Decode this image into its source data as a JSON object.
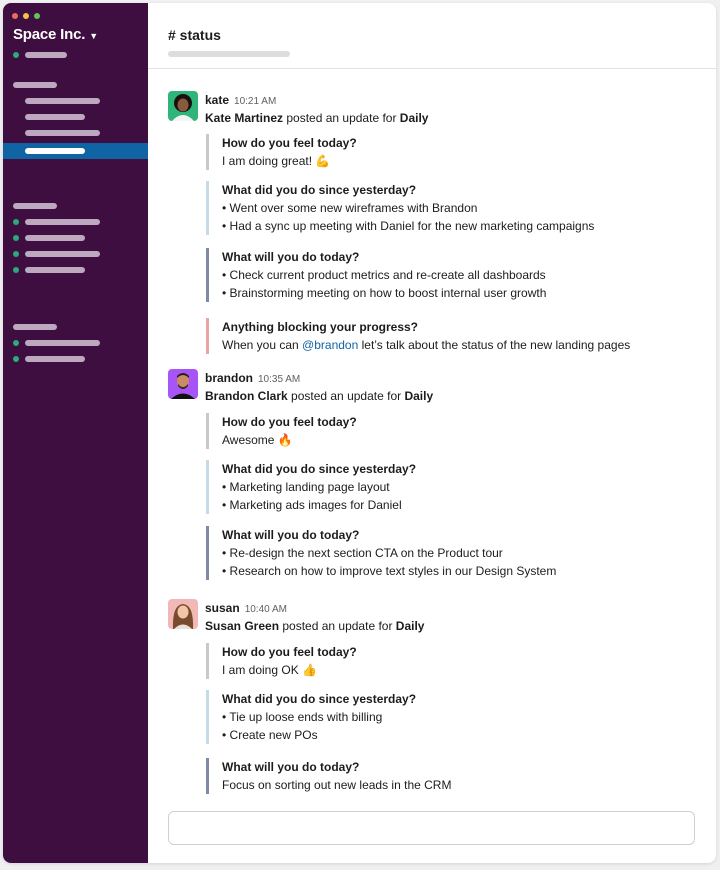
{
  "sidebar": {
    "workspace_name": "Space Inc.",
    "traffic_colors": [
      "#ed6a5e",
      "#f5bf4f",
      "#61c554"
    ],
    "sidebar_bg": "#3f0e40",
    "active_color": "#1164a3",
    "presence_color": "#2bac76"
  },
  "header": {
    "channel": "# status"
  },
  "messages": [
    {
      "user": "kate",
      "time": "10:21 AM",
      "full_name": "Kate Martinez",
      "posted_prefix": " posted an update for ",
      "standup": "Daily",
      "blocks": [
        {
          "color": "#c9c9c9",
          "q": "How do you feel today?",
          "lines": [
            "I am doing great! 💪"
          ]
        },
        {
          "color": "#c6dbe6",
          "q": "What did you do since yesterday?",
          "lines": [
            "• Went over some new wireframes with Brandon",
            "• Had a sync up meeting with Daniel for the new marketing campaigns"
          ]
        },
        {
          "color": "#7f8aa6",
          "q": "What will you do today?",
          "lines": [
            "• Check current product metrics and re-create all dashboards",
            "• Brainstorming meeting on how to boost internal user growth"
          ]
        },
        {
          "color": "#e6a6a6",
          "q": "Anything blocking your progress?",
          "lines": [
            "When you can ",
            "@brandon",
            " let’s talk about the status of the new landing pages"
          ]
        }
      ]
    },
    {
      "user": "brandon",
      "time": "10:35 AM",
      "full_name": "Brandon Clark",
      "posted_prefix": " posted an update for ",
      "standup": "Daily",
      "blocks": [
        {
          "color": "#c9c9c9",
          "q": "How do you feel today?",
          "lines": [
            "Awesome 🔥"
          ]
        },
        {
          "color": "#c6dbe6",
          "q": "What did you do since yesterday?",
          "lines": [
            "• Marketing landing page layout",
            "• Marketing ads images for Daniel"
          ]
        },
        {
          "color": "#7f8aa6",
          "q": "What will you do today?",
          "lines": [
            "• Re-design the next section CTA on the Product tour",
            "• Research on how to improve text styles in our Design System"
          ]
        }
      ]
    },
    {
      "user": "susan",
      "time": "10:40 AM",
      "full_name": "Susan Green",
      "posted_prefix": " posted an update for ",
      "standup": "Daily",
      "blocks": [
        {
          "color": "#c9c9c9",
          "q": "How do you feel today?",
          "lines": [
            "I am doing OK 👍"
          ]
        },
        {
          "color": "#c6dbe6",
          "q": "What did you do since yesterday?",
          "lines": [
            "• Tie up loose ends with billing",
            "• Create new POs"
          ]
        },
        {
          "color": "#7f8aa6",
          "q": "What will you do today?",
          "lines": [
            "Focus on sorting out new leads in the CRM"
          ]
        }
      ]
    }
  ]
}
